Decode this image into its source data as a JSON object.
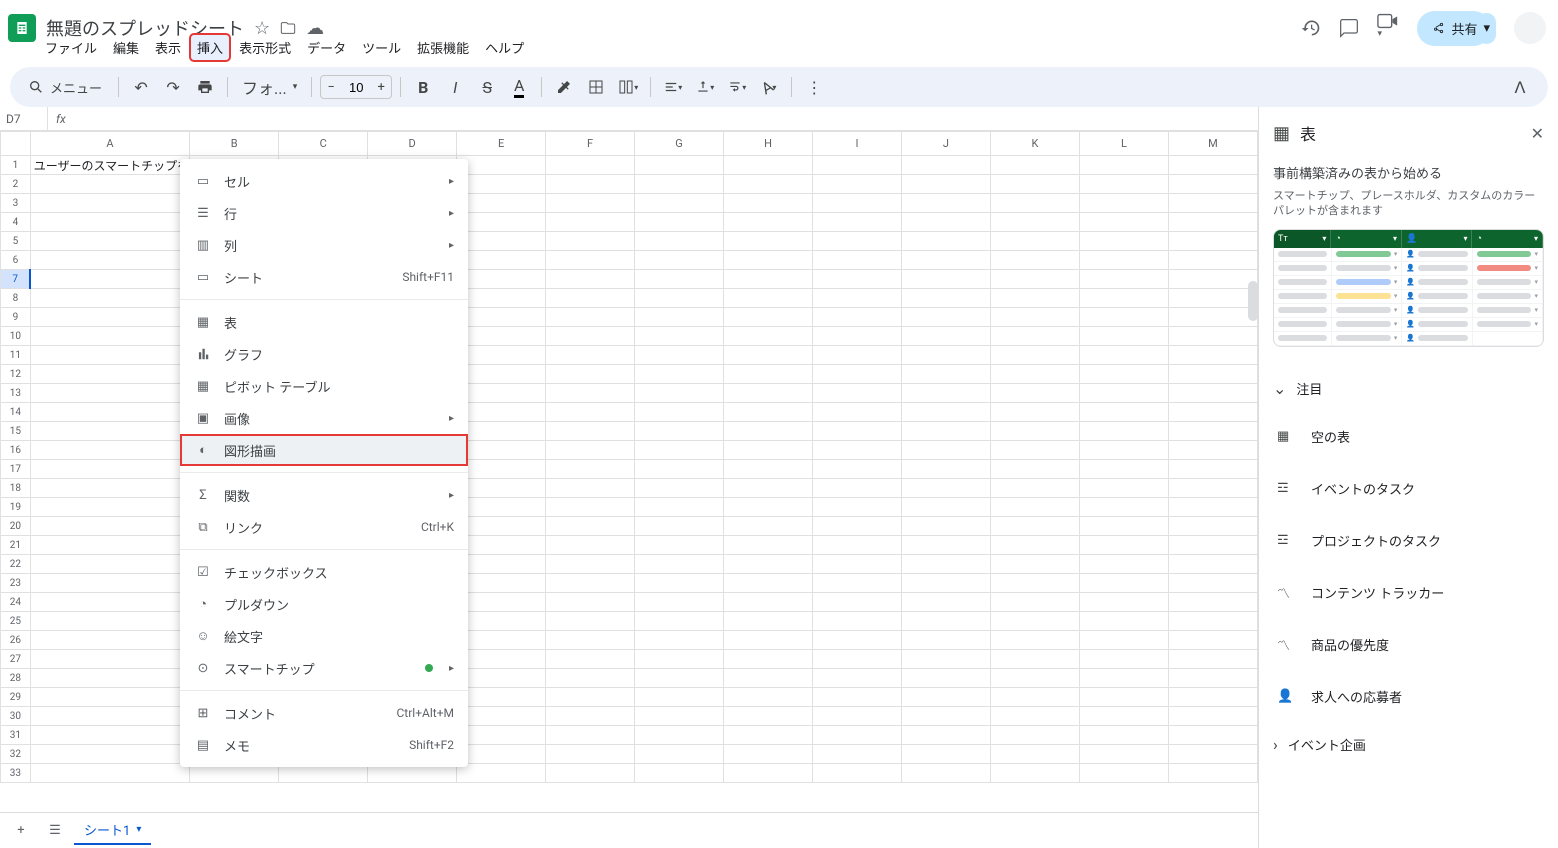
{
  "doc_title": "無題のスプレッドシート",
  "menubar": {
    "file": "ファイル",
    "edit": "編集",
    "view": "表示",
    "insert": "挿入",
    "format": "表示形式",
    "data": "データ",
    "tools": "ツール",
    "extensions": "拡張機能",
    "help": "ヘルプ"
  },
  "share_label": "共有",
  "toolbar": {
    "menu_search": "メニュー",
    "font_label": "フォ...",
    "font_size": "10"
  },
  "namebox": "D7",
  "cell_a1": "ユーザーのスマートチップを",
  "columns": [
    "A",
    "B",
    "C",
    "D",
    "E",
    "F",
    "G",
    "H",
    "I",
    "J",
    "K",
    "L",
    "M"
  ],
  "rows_count": 33,
  "selected_row": 7,
  "dropdown": {
    "cell": "セル",
    "row": "行",
    "column": "列",
    "sheet": "シート",
    "sheet_shortcut": "Shift+F11",
    "table": "表",
    "chart": "グラフ",
    "pivot": "ピボット テーブル",
    "image": "画像",
    "drawing": "図形描画",
    "function": "関数",
    "link": "リンク",
    "link_shortcut": "Ctrl+K",
    "checkbox": "チェックボックス",
    "pulldown": "プルダウン",
    "emoji": "絵文字",
    "smartchip": "スマートチップ",
    "comment": "コメント",
    "comment_shortcut": "Ctrl+Alt+M",
    "memo": "メモ",
    "memo_shortcut": "Shift+F2"
  },
  "sidepanel": {
    "title": "表",
    "subtitle": "事前構築済みの表から始める",
    "description": "スマートチップ、プレースホルダ、カスタムのカラーパレットが含まれます",
    "featured": "注目",
    "options": {
      "empty_table": "空の表",
      "event_tasks": "イベントのタスク",
      "project_tasks": "プロジェクトのタスク",
      "content_tracker": "コンテンツ トラッカー",
      "product_priority": "商品の優先度",
      "job_applicants": "求人への応募者",
      "event_planning": "イベント企画"
    }
  },
  "sheet_tab": "シート1"
}
